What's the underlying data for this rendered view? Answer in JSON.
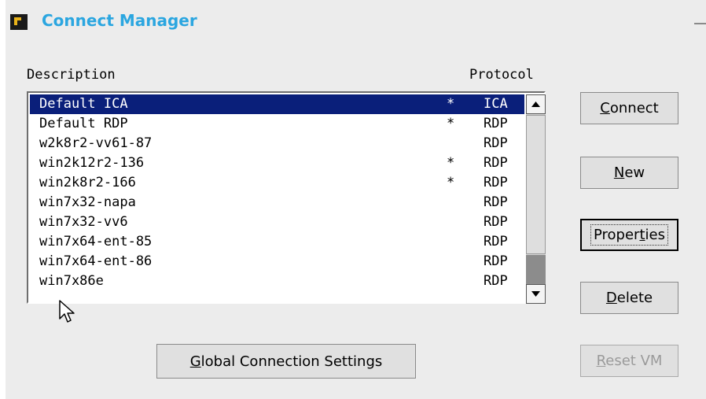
{
  "window": {
    "title": "Connect Manager",
    "app_icon": "citrix-connect-icon",
    "minimize_icon": "minimize-icon"
  },
  "list": {
    "headers": {
      "description": "Description",
      "protocol": "Protocol"
    },
    "rows": [
      {
        "description": "Default ICA",
        "mark": "*",
        "protocol": "ICA",
        "selected": true
      },
      {
        "description": "Default RDP",
        "mark": "*",
        "protocol": "RDP",
        "selected": false
      },
      {
        "description": "w2k8r2-vv61-87",
        "mark": "",
        "protocol": "RDP",
        "selected": false
      },
      {
        "description": "win2k12r2-136",
        "mark": "*",
        "protocol": "RDP",
        "selected": false
      },
      {
        "description": "win2k8r2-166",
        "mark": "*",
        "protocol": "RDP",
        "selected": false
      },
      {
        "description": "win7x32-napa",
        "mark": "",
        "protocol": "RDP",
        "selected": false
      },
      {
        "description": "win7x32-vv6",
        "mark": "",
        "protocol": "RDP",
        "selected": false
      },
      {
        "description": "win7x64-ent-85",
        "mark": "",
        "protocol": "RDP",
        "selected": false
      },
      {
        "description": "win7x64-ent-86",
        "mark": "",
        "protocol": "RDP",
        "selected": false
      },
      {
        "description": "win7x86e",
        "mark": "",
        "protocol": "RDP",
        "selected": false
      }
    ],
    "selection_color": "#0a1f7a"
  },
  "buttons": {
    "connect": {
      "pre": "",
      "mnemonic": "C",
      "post": "onnect"
    },
    "new": {
      "pre": "",
      "mnemonic": "N",
      "post": "ew"
    },
    "properties": {
      "pre": "Proper",
      "mnemonic": "t",
      "post": "ies"
    },
    "delete": {
      "pre": "",
      "mnemonic": "D",
      "post": "elete"
    },
    "reset_vm": {
      "pre": "",
      "mnemonic": "R",
      "post": "eset VM"
    },
    "global_settings": {
      "pre": "",
      "mnemonic": "G",
      "post": "lobal Connection Settings"
    }
  },
  "colors": {
    "title": "#2ba6e0",
    "window_bg": "#ececec"
  }
}
